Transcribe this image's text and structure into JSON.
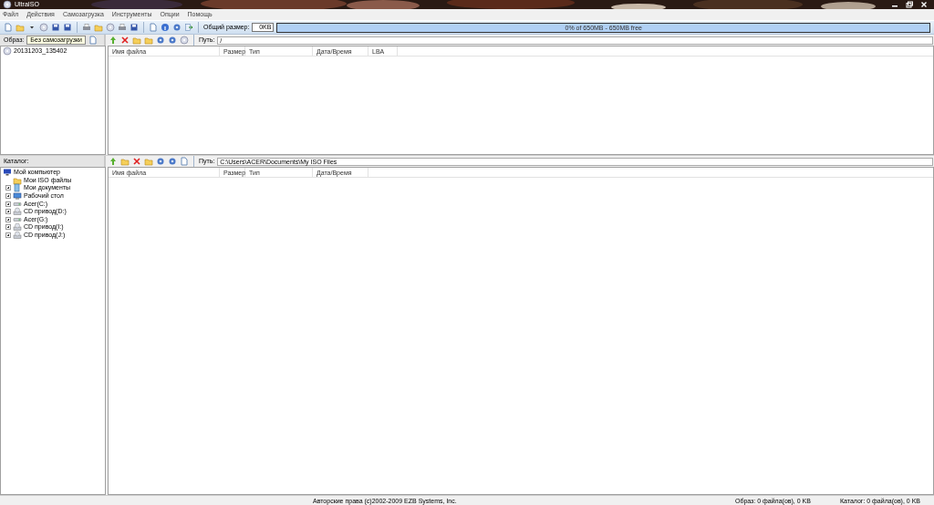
{
  "window": {
    "title": "UltraISO"
  },
  "menu": [
    "Файл",
    "Действия",
    "Самозагрузка",
    "Инструменты",
    "Опции",
    "Помощь"
  ],
  "toolbar": {
    "size_label": "Общий размер:",
    "size_value": "0KB",
    "capacity": {
      "text": "0% of 650MB - 650MB free",
      "level": 0
    }
  },
  "image_panel": {
    "label": "Образ:",
    "boot_mode": "Без самозагрузки",
    "tree": [
      {
        "label": "20131203_135402",
        "kind": "disc"
      }
    ]
  },
  "image_list": {
    "path_label": "Путь:",
    "path": "/",
    "columns": [
      "Имя файла",
      "Размер",
      "Тип",
      "Дата/Время",
      "LBA"
    ]
  },
  "catalog_panel": {
    "label": "Каталог:",
    "tree": [
      {
        "label": "Мой компьютер",
        "kind": "computer",
        "expandable": false,
        "children": [
          {
            "label": "Мои ISO файлы",
            "kind": "folder",
            "expandable": false
          },
          {
            "label": "Мои документы",
            "kind": "documents",
            "expandable": true
          },
          {
            "label": "Рабочий стол",
            "kind": "desktop",
            "expandable": true
          },
          {
            "label": "Acer(C:)",
            "kind": "drive",
            "expandable": true
          },
          {
            "label": "CD привод(D:)",
            "kind": "cd",
            "expandable": true
          },
          {
            "label": "Acer(G:)",
            "kind": "drive",
            "expandable": true
          },
          {
            "label": "CD привод(I:)",
            "kind": "cd",
            "expandable": true
          },
          {
            "label": "CD привод(J:)",
            "kind": "cd",
            "expandable": true
          }
        ]
      }
    ]
  },
  "catalog_list": {
    "path_label": "Путь:",
    "path": "C:\\Users\\ACER\\Documents\\My ISO Files",
    "columns": [
      "Имя файла",
      "Размер",
      "Тип",
      "Дата/Время"
    ]
  },
  "status_bar": {
    "copyright": "Авторские права (c)2002-2009 EZB Systems, Inc.",
    "image_info": "Образ: 0 файла(ов), 0 KB",
    "catalog_info": "Каталог: 0 файла(ов), 0 KB"
  }
}
